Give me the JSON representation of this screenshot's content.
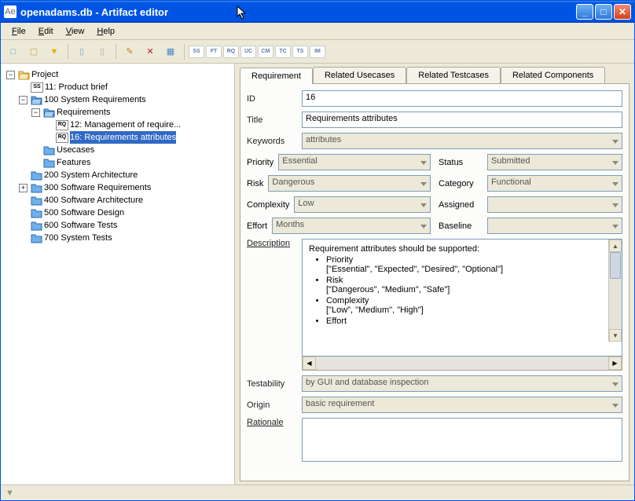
{
  "window": {
    "title": "openadams.db - Artifact editor",
    "icon_label": "Ae"
  },
  "menus": [
    "File",
    "Edit",
    "View",
    "Help"
  ],
  "toolbar": [
    {
      "name": "new-icon",
      "glyph": "□",
      "color": "#6a90c2"
    },
    {
      "name": "open-icon",
      "glyph": "▢",
      "color": "#caa64c"
    },
    {
      "name": "filter-icon",
      "glyph": "▼",
      "color": "#e0b000"
    },
    {
      "name": "SEP"
    },
    {
      "name": "page-icon",
      "glyph": "▯",
      "color": "#7aa8d4"
    },
    {
      "name": "copy-icon",
      "glyph": "▯",
      "color": "#b7b19a"
    },
    {
      "name": "SEP"
    },
    {
      "name": "edit-icon",
      "glyph": "✎",
      "color": "#c08020"
    },
    {
      "name": "delete-icon",
      "glyph": "✕",
      "color": "#b02020"
    },
    {
      "name": "report-icon",
      "glyph": "▦",
      "color": "#4c87c7"
    },
    {
      "name": "SEP"
    },
    {
      "name": "ss-icon",
      "glyph": "SS",
      "color": "#5d7cad"
    },
    {
      "name": "ft-icon",
      "glyph": "FT",
      "color": "#5d7cad"
    },
    {
      "name": "rq-icon",
      "glyph": "RQ",
      "color": "#5d7cad"
    },
    {
      "name": "uc-icon",
      "glyph": "UC",
      "color": "#5d7cad"
    },
    {
      "name": "cm-icon",
      "glyph": "CM",
      "color": "#5d7cad"
    },
    {
      "name": "tc-icon",
      "glyph": "TC",
      "color": "#5d7cad"
    },
    {
      "name": "ts-icon",
      "glyph": "TS",
      "color": "#5d7cad"
    },
    {
      "name": "im-icon",
      "glyph": "IM",
      "color": "#5d7cad"
    }
  ],
  "tree": {
    "root": "Project",
    "ss_item": {
      "badge": "SS",
      "label": "11: Product brief"
    },
    "nodes": [
      {
        "label": "100 System Requirements",
        "expanded": true,
        "children_key": "req_children"
      },
      {
        "label": "200 System Architecture"
      },
      {
        "label": "300 Software Requirements",
        "expandable": true
      },
      {
        "label": "400 Software Architecture"
      },
      {
        "label": "500 Software Design"
      },
      {
        "label": "600 Software Tests"
      },
      {
        "label": "700 System Tests"
      }
    ],
    "req_children": {
      "folder": "Requirements",
      "items": [
        {
          "badge": "RQ",
          "label": "12: Management of require..."
        },
        {
          "badge": "RQ",
          "label": "16: Requirements attributes",
          "selected": true
        }
      ],
      "siblings": [
        "Usecases",
        "Features"
      ]
    }
  },
  "tabs": [
    "Requirement",
    "Related Usecases",
    "Related Testcases",
    "Related Components"
  ],
  "active_tab": 0,
  "form": {
    "id": {
      "label": "ID",
      "value": "16"
    },
    "title": {
      "label": "Title",
      "value": "Requirements attributes"
    },
    "keywords": {
      "label": "Keywords",
      "value": "attributes"
    },
    "priority": {
      "label": "Priority",
      "value": "Essential"
    },
    "status": {
      "label": "Status",
      "value": "Submitted"
    },
    "risk": {
      "label": "Risk",
      "value": "Dangerous"
    },
    "category": {
      "label": "Category",
      "value": "Functional"
    },
    "complexity": {
      "label": "Complexity",
      "value": "Low"
    },
    "assigned": {
      "label": "Assigned",
      "value": ""
    },
    "effort": {
      "label": "Effort",
      "value": "Months"
    },
    "baseline": {
      "label": "Baseline",
      "value": ""
    },
    "description_label": "Description",
    "description_intro": "Requirement attributes should be supported:",
    "description_items": [
      {
        "name": "Priority",
        "values": "[\"Essential\", \"Expected\", \"Desired\", \"Optional\"]"
      },
      {
        "name": "Risk",
        "values": "[\"Dangerous\", \"Medium\", \"Safe\"]"
      },
      {
        "name": "Complexity",
        "values": "[\"Low\", \"Medium\", \"High\"]"
      },
      {
        "name": "Effort",
        "values": ""
      }
    ],
    "testability": {
      "label": "Testability",
      "value": "by GUI and database inspection"
    },
    "origin": {
      "label": "Origin",
      "value": "basic requirement"
    },
    "rationale_label": "Rationale"
  }
}
